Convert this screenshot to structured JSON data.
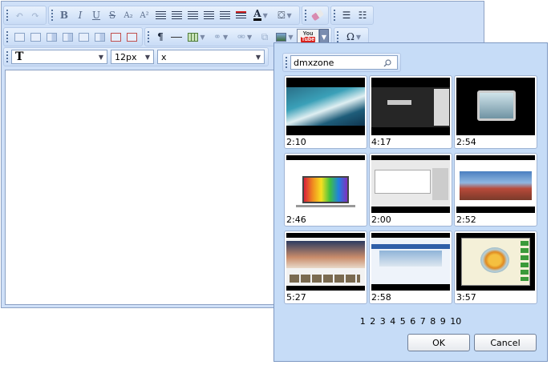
{
  "toolbar": {
    "font_family_value": "T",
    "font_size_value": "12px",
    "style_value": "x",
    "youtube_line1": "You",
    "youtube_line2": "Tube",
    "paragraph_label": "¶",
    "omega_label": "Ω",
    "bold": "B",
    "italic": "I",
    "underline": "U",
    "strike": "S",
    "subscript": "A₂",
    "superscript": "A²",
    "font_color": "A"
  },
  "dialog": {
    "search_value": "dmxzone",
    "videos": [
      {
        "duration": "2:10"
      },
      {
        "duration": "4:17"
      },
      {
        "duration": "2:54"
      },
      {
        "duration": "2:46"
      },
      {
        "duration": "2:00"
      },
      {
        "duration": "2:52"
      },
      {
        "duration": "5:27"
      },
      {
        "duration": "2:58"
      },
      {
        "duration": "3:57"
      }
    ],
    "pages": [
      "1",
      "2",
      "3",
      "4",
      "5",
      "6",
      "7",
      "8",
      "9",
      "10"
    ],
    "ok_label": "OK",
    "cancel_label": "Cancel"
  },
  "colors": {
    "toolbar_bg": "#cfe0f8",
    "dialog_bg": "#c6dcf7",
    "border": "#8da2c4",
    "youtube_red": "#d9201b"
  }
}
